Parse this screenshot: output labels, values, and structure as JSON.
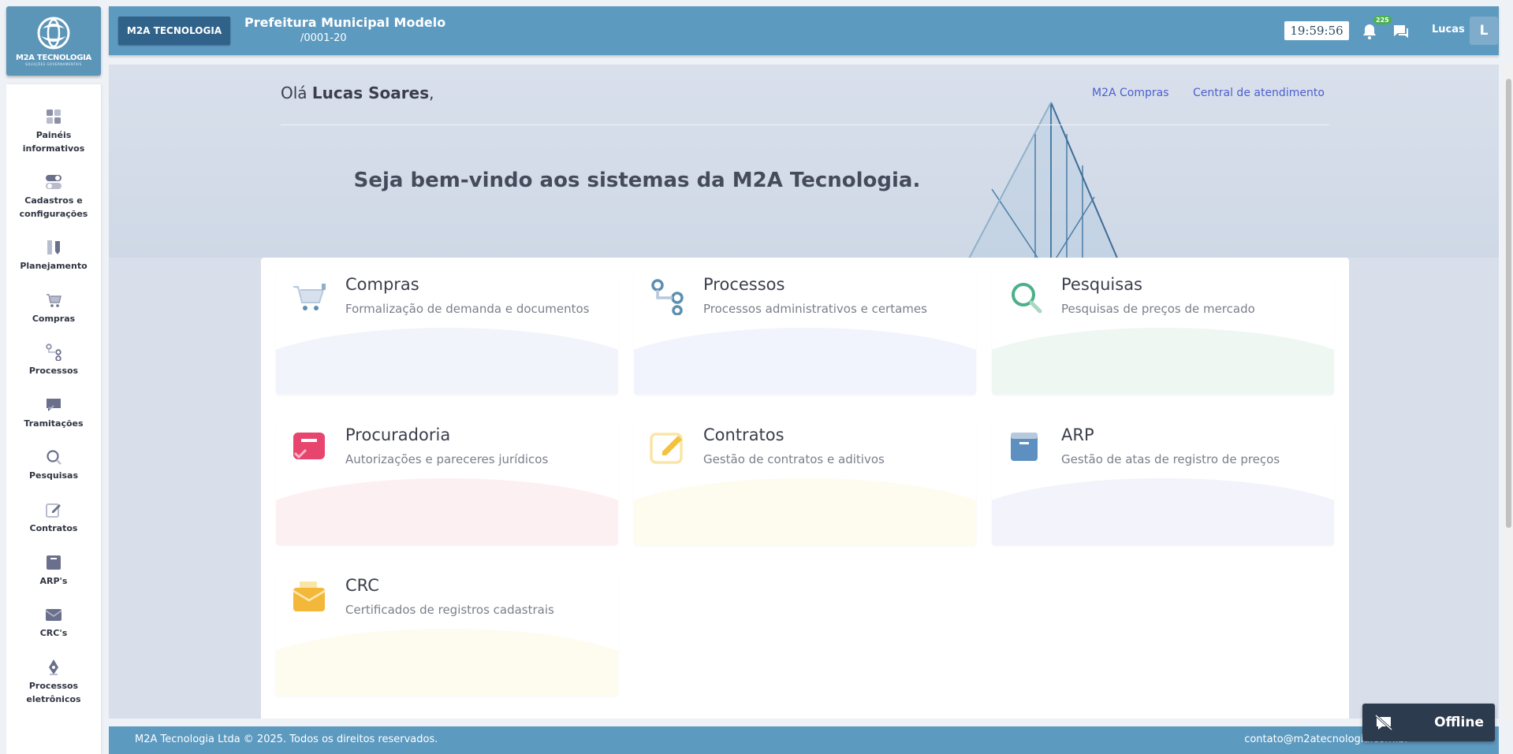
{
  "logo": {
    "brand": "M2A TECNOLOGIA",
    "tagline": "SOLUÇÕES GOVERNAMENTAIS"
  },
  "sidebar": {
    "items": [
      {
        "label": "Painéis\ninformativos",
        "icon": "dashboard-icon"
      },
      {
        "label": "Cadastros e\nconfigurações",
        "icon": "toggle-icon"
      },
      {
        "label": "Planejamento",
        "icon": "pencil-ruler-icon"
      },
      {
        "label": "Compras",
        "icon": "cart-icon"
      },
      {
        "label": "Processos",
        "icon": "process-icon"
      },
      {
        "label": "Tramitações",
        "icon": "message-check-icon"
      },
      {
        "label": "Pesquisas",
        "icon": "search-icon"
      },
      {
        "label": "Contratos",
        "icon": "edit-icon"
      },
      {
        "label": "ARP's",
        "icon": "archive-icon"
      },
      {
        "label": "CRC's",
        "icon": "envelope-icon"
      },
      {
        "label": "Processos\neletrônicos",
        "icon": "pen-nib-icon"
      }
    ]
  },
  "topbar": {
    "chip": "M2A TECNOLOGIA",
    "org_name": "Prefeitura Municipal Modelo",
    "org_cnpj": "/0001-20",
    "clock": "19:59:56",
    "notif_count": "225",
    "user_name": "Lucas",
    "avatar_initial": "L"
  },
  "main": {
    "greeting_prefix": "Olá ",
    "greeting_name": "Lucas Soares",
    "greeting_suffix": ",",
    "links": [
      "M2A Compras",
      "Central de atendimento"
    ],
    "welcome": "Seja bem-vindo aos sistemas da M2A Tecnologia.",
    "cards": [
      {
        "title": "Compras",
        "subtitle": "Formalização de demanda e documentos",
        "icon": "cart-icon",
        "color": "#b7c9dc",
        "wave": "#f2f4fb"
      },
      {
        "title": "Processos",
        "subtitle": "Processos administrativos e certames",
        "icon": "process-icon",
        "color": "#5d8fb0",
        "wave": "#f1f4fc"
      },
      {
        "title": "Pesquisas",
        "subtitle": "Pesquisas de preços de mercado",
        "icon": "search-icon",
        "color": "#4bb08a",
        "wave": "#eff7f3"
      },
      {
        "title": "Procuradoria",
        "subtitle": "Autorizações e pareceres jurídicos",
        "icon": "legal-icon",
        "color": "#e8456e",
        "wave": "#fdf0f2"
      },
      {
        "title": "Contratos",
        "subtitle": "Gestão de contratos e aditivos",
        "icon": "edit-icon",
        "color": "#f3c23e",
        "wave": "#fefbef"
      },
      {
        "title": "ARP",
        "subtitle": "Gestão de atas de registro de preços",
        "icon": "archive-icon",
        "color": "#5d8fc0",
        "wave": "#f2f3fb"
      },
      {
        "title": "CRC",
        "subtitle": "Certificados de registros cadastrais",
        "icon": "envelope-icon",
        "color": "#f3b83a",
        "wave": "#fefbef"
      }
    ]
  },
  "footer": {
    "copyright": "M2A Tecnologia Ltda  © 2025. Todos os direitos reservados.",
    "email": "contato@m2atecnologia.com.br"
  },
  "offline": {
    "label": "Offline",
    "icon": "chat-off-icon"
  }
}
